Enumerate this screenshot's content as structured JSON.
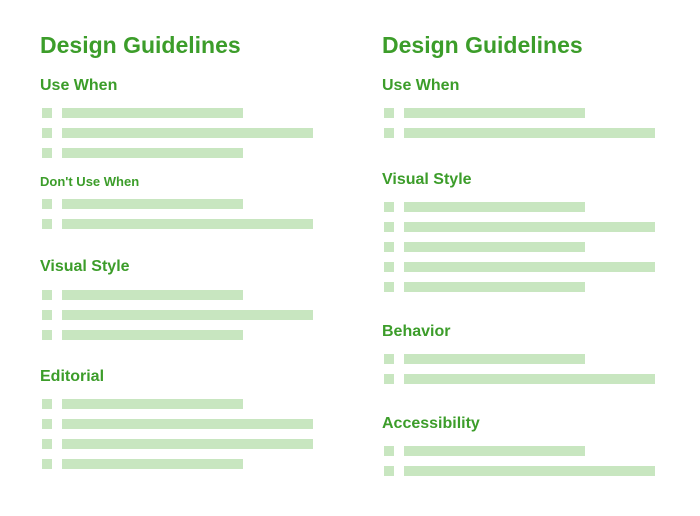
{
  "colors": {
    "heading": "#3c9d2a",
    "placeholder": "#c8e6c0",
    "background": "#ffffff"
  },
  "left": {
    "title": "Design Guidelines",
    "sections": [
      {
        "heading": "Use When",
        "lines": [
          "short",
          "long",
          "short"
        ]
      },
      {
        "heading": "Don't Use When",
        "lines": [
          "short",
          "long"
        ]
      },
      {
        "heading": "Visual Style",
        "lines": [
          "short",
          "long",
          "short"
        ]
      },
      {
        "heading": "Editorial",
        "lines": [
          "short",
          "long",
          "long",
          "short"
        ]
      }
    ]
  },
  "right": {
    "title": "Design Guidelines",
    "sections": [
      {
        "heading": "Use When",
        "lines": [
          "short",
          "long"
        ]
      },
      {
        "heading": "Visual Style",
        "lines": [
          "short",
          "long",
          "short",
          "long",
          "short"
        ]
      },
      {
        "heading": "Behavior",
        "lines": [
          "short",
          "long"
        ]
      },
      {
        "heading": "Accessibility",
        "lines": [
          "short",
          "long"
        ]
      }
    ]
  }
}
